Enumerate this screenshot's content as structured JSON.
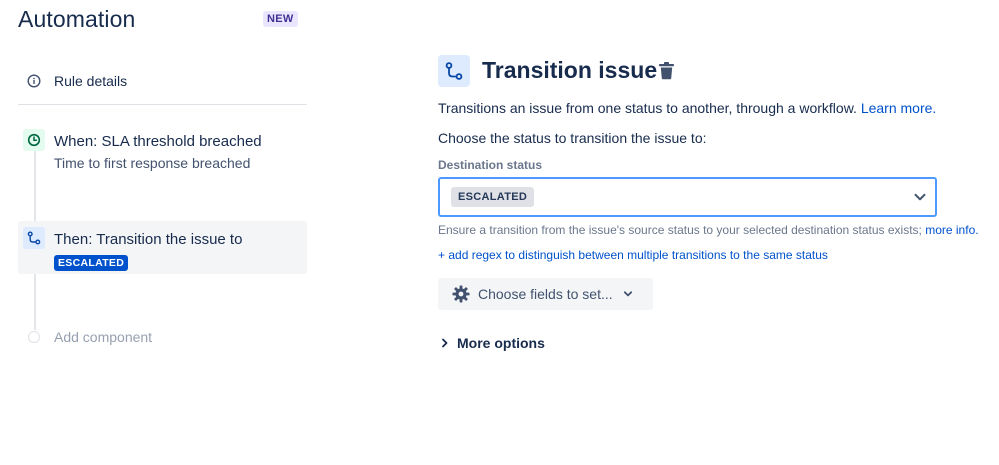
{
  "sidebar": {
    "app_title": "Automation",
    "new_badge": "NEW",
    "rule_details_label": "Rule details",
    "steps": [
      {
        "title": "When: SLA threshold breached",
        "subtitle": "Time to first response breached",
        "icon": "clock-icon"
      },
      {
        "title": "Then: Transition the issue to",
        "status": "ESCALATED",
        "icon": "transition-icon"
      }
    ],
    "add_component_label": "Add component"
  },
  "panel": {
    "title": "Transition issue",
    "description": "Transitions an issue from one status to another, through a workflow.",
    "learn_more": "Learn more.",
    "choose_status_text": "Choose the status to transition the issue to:",
    "destination_label": "Destination status",
    "destination_value": "ESCALATED",
    "hint_text": "Ensure a transition from the issue's source status to your selected destination status exists;",
    "hint_link": "more info.",
    "regex_link": "+ add regex to distinguish between multiple transitions to the same status",
    "choose_fields_label": "Choose fields to set...",
    "more_options_label": "More options"
  },
  "colors": {
    "primary": "#0052cc",
    "focus_border": "#4c9aff",
    "text": "#172b4d",
    "subtle_text": "#6b778c",
    "new_badge_bg": "#eae6ff",
    "trigger_icon_bg": "#e3fcef",
    "action_icon_bg": "#deebff"
  }
}
